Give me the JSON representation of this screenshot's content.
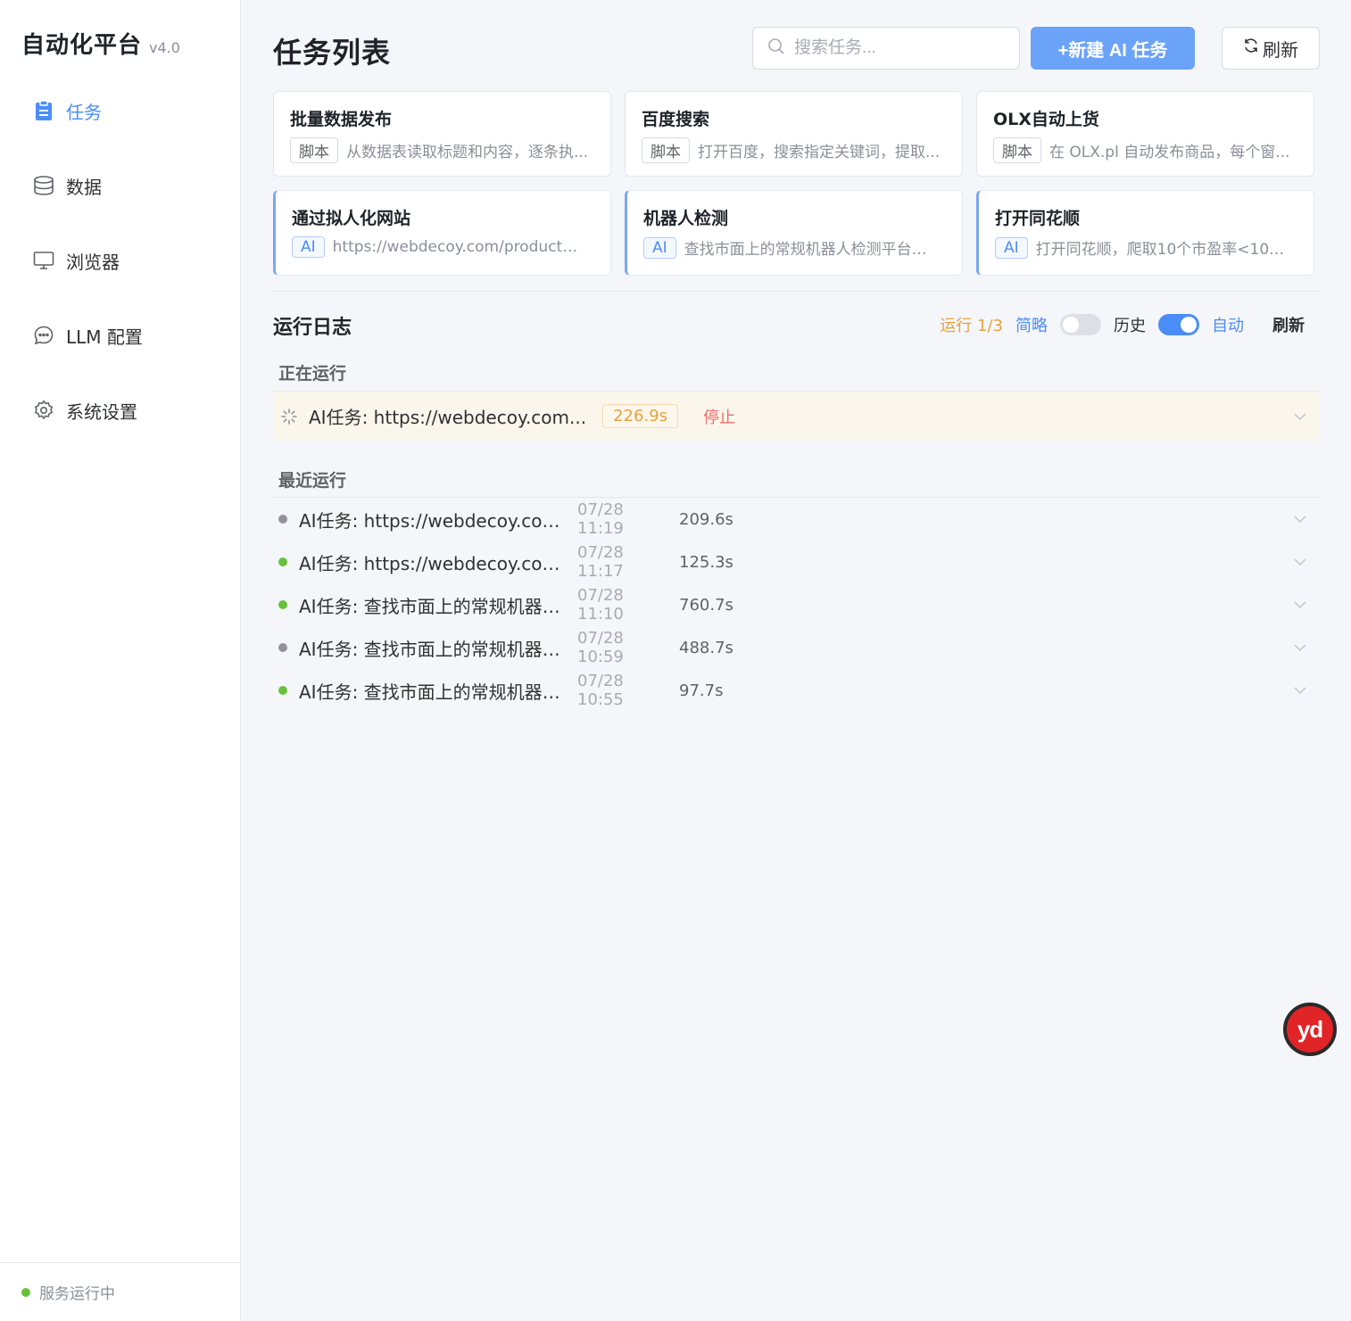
{
  "sidebar": {
    "brand_title": "自动化平台",
    "brand_version": "v4.0",
    "items": [
      {
        "label": "任务",
        "icon": "clipboard-icon",
        "active": true
      },
      {
        "label": "数据",
        "icon": "database-icon",
        "active": false
      },
      {
        "label": "浏览器",
        "icon": "monitor-icon",
        "active": false
      },
      {
        "label": "LLM 配置",
        "icon": "chat-icon",
        "active": false
      },
      {
        "label": "系统设置",
        "icon": "gear-icon",
        "active": false
      }
    ],
    "status": "服务运行中"
  },
  "header": {
    "title": "任务列表",
    "search_placeholder": "搜索任务...",
    "new_button": "+新建 AI 任务",
    "refresh_button": "刷新"
  },
  "tasks": [
    {
      "title": "批量数据发布",
      "tag": "脚本",
      "desc": "从数据表读取标题和内容，逐条执..."
    },
    {
      "title": "百度搜索",
      "tag": "脚本",
      "desc": "打开百度，搜索指定关键词，提取..."
    },
    {
      "title": "OLX自动上货",
      "tag": "脚本",
      "desc": "在 OLX.pl 自动发布商品，每个窗..."
    },
    {
      "title": "通过拟人化网站",
      "tag": "AI",
      "desc": "https://webdecoy.com/product/fc..."
    },
    {
      "title": "机器人检测",
      "tag": "AI",
      "desc": "查找市面上的常规机器人检测平台，..."
    },
    {
      "title": "打开同花顺",
      "tag": "AI",
      "desc": "打开同花顺，爬取10个市盈率<10股..."
    }
  ],
  "log": {
    "title": "运行日志",
    "run_count": "运行 1/3",
    "brief_label": "简略",
    "history_label": "历史",
    "auto_label": "自动",
    "refresh_label": "刷新",
    "history_on": false,
    "auto_on": true,
    "running_label": "正在运行",
    "running": {
      "name": "AI任务: https://webdecoy.com...",
      "duration": "226.9s",
      "stop": "停止"
    },
    "recent_label": "最近运行",
    "recent": [
      {
        "name": "AI任务: https://webdecoy.com...",
        "time": "07/28 11:19",
        "duration": "209.6s",
        "status": "grey"
      },
      {
        "name": "AI任务: https://webdecoy.com...",
        "time": "07/28 11:17",
        "duration": "125.3s",
        "status": "green"
      },
      {
        "name": "AI任务: 查找市面上的常规机器人...",
        "time": "07/28 11:10",
        "duration": "760.7s",
        "status": "green"
      },
      {
        "name": "AI任务: 查找市面上的常规机器人...",
        "time": "07/28 10:59",
        "duration": "488.7s",
        "status": "grey"
      },
      {
        "name": "AI任务: 查找市面上的常规机器人...",
        "time": "07/28 10:55",
        "duration": "97.7s",
        "status": "green"
      }
    ]
  },
  "badge": {
    "text": "yd"
  },
  "colors": {
    "accent": "#4b8df8",
    "button": "#6aa3f8",
    "success": "#67c23a",
    "warning": "#e6a23c",
    "danger": "#f56c6c"
  }
}
